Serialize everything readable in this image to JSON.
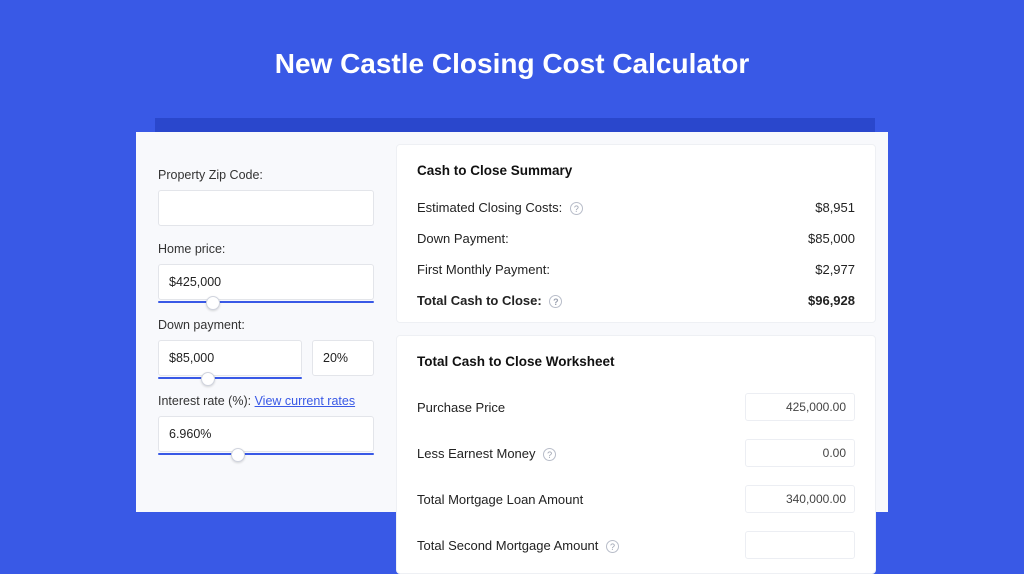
{
  "title": "New Castle Closing Cost Calculator",
  "left": {
    "zip_label": "Property Zip Code:",
    "zip_value": "",
    "price_label": "Home price:",
    "price_value": "$425,000",
    "down_label": "Down payment:",
    "down_value": "$85,000",
    "down_pct": "20%",
    "rate_label": "Interest rate (%): ",
    "rate_link": "View current rates",
    "rate_value": "6.960%"
  },
  "summary": {
    "title": "Cash to Close Summary",
    "rows": {
      "est_costs_label": "Estimated Closing Costs:",
      "est_costs_value": "$8,951",
      "down_label": "Down Payment:",
      "down_value": "$85,000",
      "first_label": "First Monthly Payment:",
      "first_value": "$2,977",
      "total_label": "Total Cash to Close:",
      "total_value": "$96,928"
    }
  },
  "worksheet": {
    "title": "Total Cash to Close Worksheet",
    "rows": {
      "purchase_label": "Purchase Price",
      "purchase_value": "425,000.00",
      "earnest_label": "Less Earnest Money",
      "earnest_value": "0.00",
      "loan_label": "Total Mortgage Loan Amount",
      "loan_value": "340,000.00",
      "second_label": "Total Second Mortgage Amount"
    }
  }
}
